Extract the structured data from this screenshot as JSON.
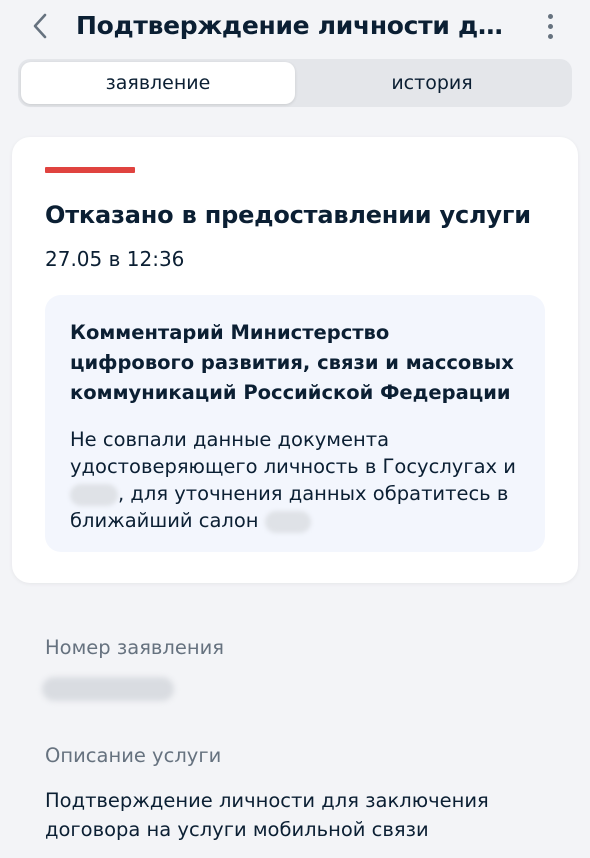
{
  "header": {
    "back_icon": "chevron-left-icon",
    "title": "Подтверждение личности для...",
    "more_icon": "more-vertical-icon"
  },
  "tabs": [
    {
      "label": "заявление",
      "active": true
    },
    {
      "label": "история",
      "active": false
    }
  ],
  "status": {
    "accent_color": "#e0433f",
    "title": "Отказано в предоставлении услуги",
    "date": "27.05 в 12:36"
  },
  "comment": {
    "heading": "Комментарий Министерство цифрового развития, связи и массовых коммуникаций Российской Федерации",
    "body_part1": "Не совпали данные документа удостоверяющего личность в Госуслугах и",
    "body_part2": ", для уточнения данных обратитесь в ближайший салон"
  },
  "fields": {
    "application_number_label": "Номер заявления",
    "service_description_label": "Описание услуги",
    "service_description_value": "Подтверждение личности для заключения договора на услуги мобильной связи"
  }
}
